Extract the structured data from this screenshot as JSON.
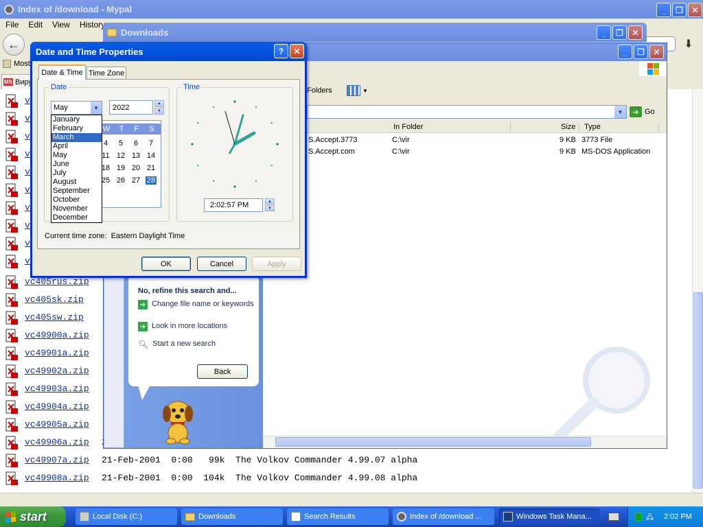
{
  "firefox": {
    "title": "Index of /download - Mypal",
    "menu": [
      "File",
      "Edit",
      "View",
      "History"
    ],
    "bookmark_most": "Most",
    "bookmark_viru": "Виру",
    "rows": [
      {
        "name": "vc405rus.zip",
        "rest": ""
      },
      {
        "name": "vc405sk.zip",
        "rest": ""
      },
      {
        "name": "vc405sw.zip",
        "rest": ""
      },
      {
        "name": "vc49900a.zip",
        "rest": ""
      },
      {
        "name": "vc49901a.zip",
        "rest": ""
      },
      {
        "name": "vc49902a.zip",
        "rest": ""
      },
      {
        "name": "vc49903a.zip",
        "rest": ""
      },
      {
        "name": "vc49904a.zip",
        "rest": ""
      },
      {
        "name": "vc49905a.zip",
        "rest": ""
      },
      {
        "name": "vc49906a.zip",
        "rest": "21-F"
      },
      {
        "name": "vc49907a.zip",
        "rest": "21-Feb-2001  0:00   99k  The Volkov Commander 4.99.07 alpha"
      },
      {
        "name": "vc49908a.zip",
        "rest": "21-Feb-2001  0:00  104k  The Volkov Commander 4.99.08 alpha"
      }
    ],
    "partial_links": [
      "vc",
      "vc",
      "vc",
      "vc",
      "vc",
      "vc",
      "vc",
      "vc",
      "vc",
      "vc"
    ]
  },
  "downloads": {
    "title": "Downloads"
  },
  "search": {
    "folders_label": "Folders",
    "go_label": "Go",
    "columns": {
      "in_folder": "In Folder",
      "size": "Size",
      "type": "Type"
    },
    "results": [
      {
        "name": "S.Accept.3773",
        "folder": "C:\\vir",
        "size": "9 KB",
        "type": "3773 File"
      },
      {
        "name": "S.Accept.com",
        "folder": "C:\\vir",
        "size": "9 KB",
        "type": "MS-DOS Application"
      }
    ],
    "refine_title": "No, refine this search and...",
    "refine_change": "Change file name or keywords",
    "refine_look": "Look in more locations",
    "refine_new": "Start a new search",
    "back_label": "Back"
  },
  "dialog": {
    "title": "Date and Time Properties",
    "tabs": [
      "Date & Time",
      "Time Zone"
    ],
    "date_legend": "Date",
    "time_legend": "Time",
    "month_selected": "May",
    "year": "2022",
    "months": [
      "January",
      "February",
      "March",
      "April",
      "May",
      "June",
      "July",
      "August",
      "September",
      "October",
      "November",
      "December"
    ],
    "highlighted_month": "March",
    "weekday_headers": [
      "W",
      "T",
      "F",
      "S"
    ],
    "cal_rows": [
      [
        "4",
        "5",
        "6",
        "7"
      ],
      [
        "11",
        "12",
        "13",
        "14"
      ],
      [
        "18",
        "19",
        "20",
        "21"
      ],
      [
        "25",
        "26",
        "27",
        "28"
      ]
    ],
    "selected_day": "28",
    "time_value": "2:02:57 PM",
    "timezone_text": "Current time zone:  Eastern Daylight Time",
    "ok_label": "OK",
    "cancel_label": "Cancel",
    "apply_label": "Apply"
  },
  "taskbar": {
    "start_label": "start",
    "buttons": [
      "Local Disk (C:)",
      "Downloads",
      "Search Results",
      "Index of /download ...",
      "Windows Task Mana..."
    ],
    "clock": "2:02 PM"
  },
  "colors": {
    "xp_blue": "#0553e0",
    "taskbar": "#245edb",
    "start_green": "#3c9a3c",
    "dialog_bg": "#ece9d8",
    "link": "#0b2ea8"
  }
}
